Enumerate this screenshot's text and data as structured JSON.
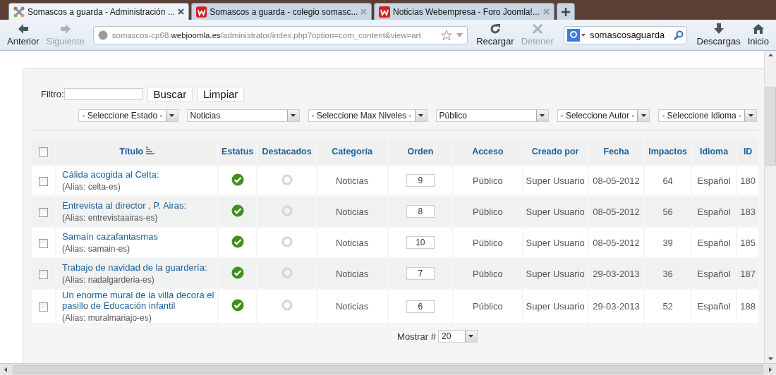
{
  "browser": {
    "tabs": [
      {
        "title": "Somascos a guarda - Administración ...",
        "selected": true
      },
      {
        "title": "Somascos a guarda - colegio somasc...",
        "selected": false
      },
      {
        "title": "Noticias Webempresa - Foro Joomla!...",
        "selected": false
      }
    ],
    "nav": [
      {
        "label": "Anterior",
        "kind": "back",
        "disabled": false
      },
      {
        "label": "Siguiente",
        "kind": "forward",
        "disabled": true
      }
    ],
    "url": "somascos-cp68.**webjoomla.es**/administrator/index.php?option=com_content&view=art",
    "actions": [
      {
        "label": "Recargar",
        "kind": "reload",
        "disabled": false
      },
      {
        "label": "Detener",
        "kind": "stop",
        "disabled": true
      }
    ],
    "search": {
      "value": "somascosaguarda"
    },
    "tools": [
      {
        "label": "Descargas",
        "kind": "download"
      },
      {
        "label": "Inicio",
        "kind": "home"
      }
    ]
  },
  "filter": {
    "label": "Filtro:",
    "buttons": [
      "Buscar",
      "Limpiar"
    ]
  },
  "selects": [
    {
      "value": "- Seleccione Estado -"
    },
    {
      "value": "Noticias"
    },
    {
      "value": "- Seleccione Max Niveles -"
    },
    {
      "value": "Público"
    },
    {
      "value": "- Seleccione Autor -"
    },
    {
      "value": "- Seleccione Idioma -"
    }
  ],
  "table": {
    "select_all_checked": false,
    "columns": [
      "Título",
      "Estatus",
      "Destacados",
      "Categoría",
      "Orden",
      "Acceso",
      "Creado por",
      "Fecha",
      "Impactos",
      "Idioma",
      "ID"
    ],
    "rows": [
      {
        "checked": false,
        "title": "Cálida acogida al Celta:",
        "alias": "(Alias: celta-es)",
        "published": true,
        "featured": false,
        "category": "Noticias",
        "order": "9",
        "access": "Público",
        "author": "Super Usuario",
        "date": "08-05-2012",
        "hits": "64",
        "language": "Español",
        "id": "180"
      },
      {
        "checked": false,
        "title": "Entrevista al director , P. Airas:",
        "alias": "(Alias: entrevistaairas-es)",
        "published": true,
        "featured": false,
        "category": "Noticias",
        "order": "8",
        "access": "Público",
        "author": "Super Usuario",
        "date": "08-05-2012",
        "hits": "56",
        "language": "Español",
        "id": "183"
      },
      {
        "checked": false,
        "title": "Samaín cazafantasmas",
        "alias": "(Alias: samain-es)",
        "published": true,
        "featured": false,
        "category": "Noticias",
        "order": "10",
        "access": "Público",
        "author": "Super Usuario",
        "date": "08-05-2012",
        "hits": "39",
        "language": "Español",
        "id": "185"
      },
      {
        "checked": false,
        "title": "Trabajo de navidad de la guardería:",
        "alias": "(Alias: nadalgarderia-es)",
        "published": true,
        "featured": false,
        "category": "Noticias",
        "order": "7",
        "access": "Público",
        "author": "Super Usuario",
        "date": "29-03-2013",
        "hits": "36",
        "language": "Español",
        "id": "187"
      },
      {
        "checked": false,
        "title": "Un enorme mural de la villa decora el pasillo de Educación infantil",
        "alias": "(Alias: muralmariajo-es)",
        "published": true,
        "featured": false,
        "category": "Noticias",
        "order": "6",
        "access": "Público",
        "author": "Super Usuario",
        "date": "29-03-2013",
        "hits": "52",
        "language": "Español",
        "id": "188"
      }
    ]
  },
  "pagination": {
    "label": "Mostrar #",
    "value": "20"
  }
}
